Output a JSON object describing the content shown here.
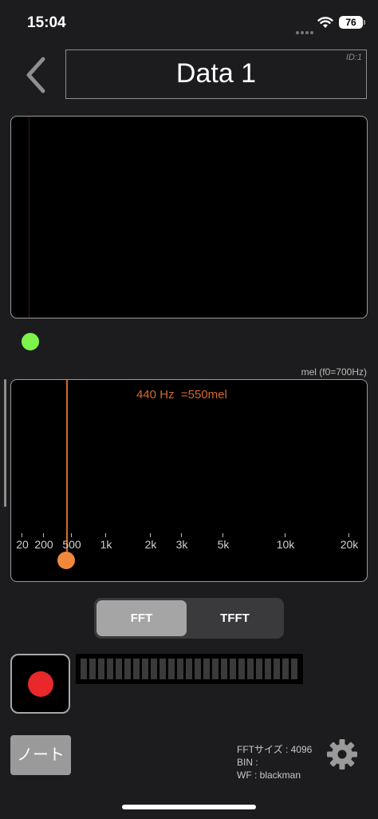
{
  "status_bar": {
    "time": "15:04",
    "battery": "76"
  },
  "header": {
    "title": "Data 1",
    "id_label": "ID:1"
  },
  "spectrum": {
    "scale_label": "mel (f0=700Hz)",
    "readout": "440 Hz  =550mel",
    "ticks": [
      "20",
      "200",
      "500",
      "1k",
      "2k",
      "3k",
      "5k",
      "10k",
      "20k"
    ]
  },
  "mode_toggle": {
    "options": [
      "FFT",
      "TFFT"
    ],
    "selected": "FFT"
  },
  "note_button": {
    "label": "ノート"
  },
  "info": {
    "fft_size": "FFTサイズ : 4096",
    "bin": "BIN :",
    "wf": "WF : blackman"
  },
  "icons": {
    "back": "chevron-left-icon",
    "settings": "gear-icon",
    "record": "record-icon"
  },
  "colors": {
    "accent": "#d2692a",
    "handle_green": "#7cf44a",
    "record_red": "#e8282a"
  }
}
